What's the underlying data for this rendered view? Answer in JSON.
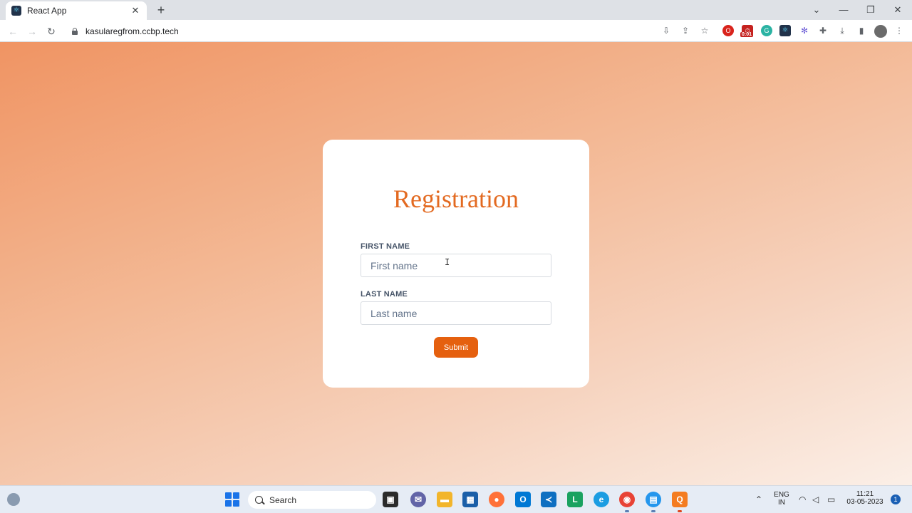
{
  "browser": {
    "tab_title": "React App",
    "url": "kasularegfrom.ccbp.tech",
    "extension_timer": "0:01"
  },
  "form": {
    "heading": "Registration",
    "first_name_label": "FIRST NAME",
    "first_name_placeholder": "First name",
    "last_name_label": "LAST NAME",
    "last_name_placeholder": "Last name",
    "submit_label": "Submit"
  },
  "taskbar": {
    "search_label": "Search",
    "language_top": "ENG",
    "language_bottom": "IN",
    "time": "11:21",
    "date": "03-05-2023",
    "notification_count": "1"
  },
  "colors": {
    "accent": "#e5600f",
    "heading": "#e36a21",
    "background_start": "#f09463",
    "background_end": "#fbefe7"
  }
}
